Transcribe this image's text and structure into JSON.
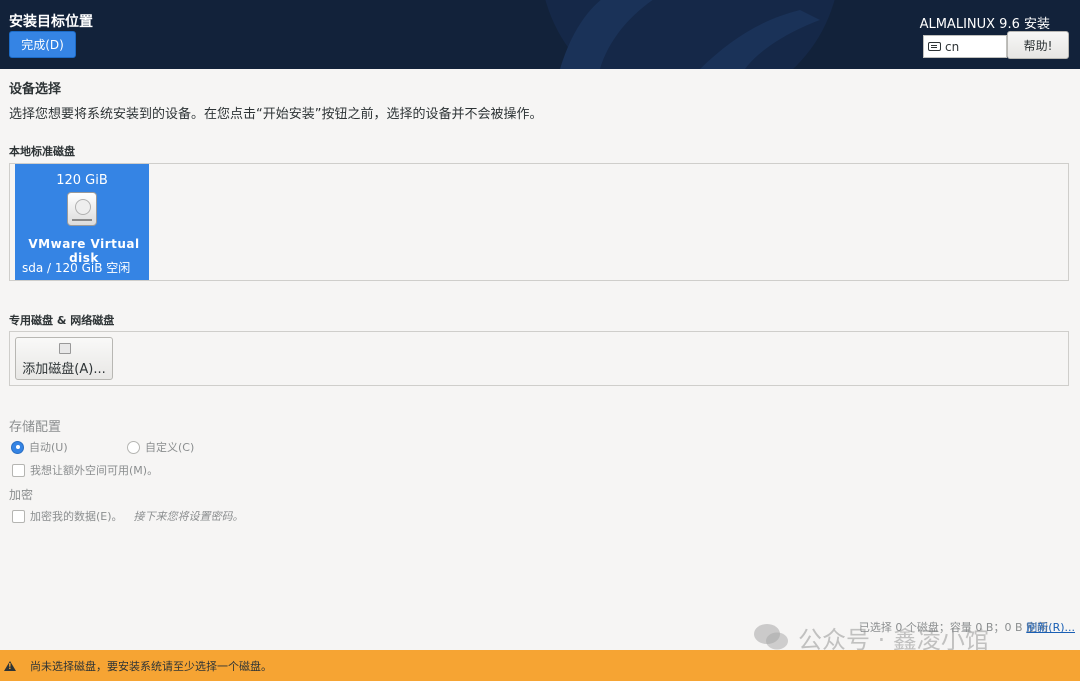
{
  "header": {
    "title": "安装目标位置",
    "done_label": "完成(D)",
    "product": "ALMALINUX 9.6 安装",
    "keyboard_layout": "cn",
    "help_label": "帮助!"
  },
  "device_selection": {
    "title": "设备选择",
    "description": "选择您想要将系统安装到的设备。在您点击“开始安装”按钮之前，选择的设备并不会被操作。"
  },
  "local_disks": {
    "label": "本地标准磁盘",
    "disks": [
      {
        "size": "120 GiB",
        "name": "VMware Virtual disk",
        "info": "sda  /  120 GiB 空闲",
        "selected": true
      }
    ]
  },
  "special_disks": {
    "label": "专用磁盘 & 网络磁盘",
    "add_label": "添加磁盘(A)..."
  },
  "storage_config": {
    "title": "存储配置",
    "auto_label": "自动(U)",
    "custom_label": "自定义(C)",
    "auto_selected": true,
    "extra_space_label": "我想让额外空间可用(M)。"
  },
  "encryption": {
    "title": "加密",
    "encrypt_label": "加密我的数据(E)。",
    "hint": "接下来您将设置密码。"
  },
  "footer": {
    "summary": "已选择 0 个磁盘；容量 0 B；0 B 空闲",
    "refresh_label": "刷新(R)..."
  },
  "watermark": {
    "text": "公众号 · 鑫凌小馆"
  },
  "warning": {
    "message": "尚未选择磁盘，要安装系统请至少选择一个磁盘。",
    "color": "#f6a433"
  },
  "colors": {
    "header_bg": "#12223a",
    "accent": "#3584e4"
  }
}
